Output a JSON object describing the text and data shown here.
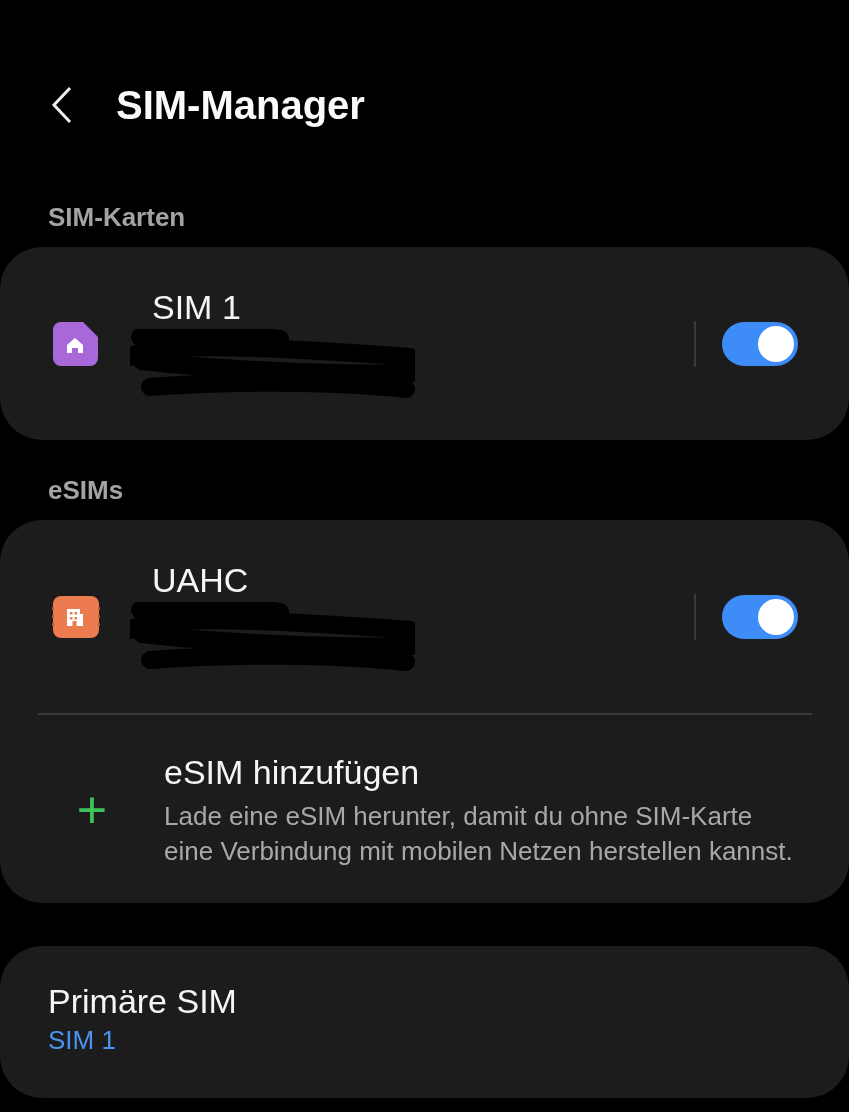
{
  "header": {
    "title": "SIM-Manager"
  },
  "sim_cards": {
    "label": "SIM-Karten",
    "items": [
      {
        "name": "SIM 1",
        "kind": "home",
        "color": "#a968d9",
        "on": true
      }
    ]
  },
  "esims": {
    "label": "eSIMs",
    "items": [
      {
        "name": "UAHC",
        "kind": "building",
        "color": "#ec7b50",
        "on": true
      }
    ],
    "add": {
      "icon": "+",
      "title": "eSIM hinzufügen",
      "description": "Lade eine eSIM herunter, damit du ohne SIM-Karte eine Verbindung mit mobilen Netzen herstellen kannst."
    }
  },
  "primary_sim": {
    "title": "Primäre SIM",
    "value": "SIM 1"
  }
}
